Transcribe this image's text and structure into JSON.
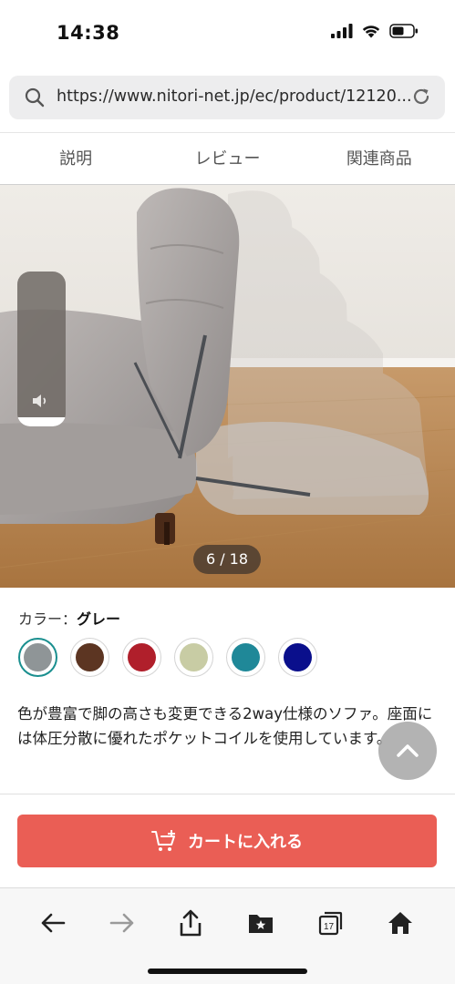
{
  "status_bar": {
    "time": "14:38"
  },
  "browser": {
    "url": "https://www.nitori-net.jp/ec/product/12120..."
  },
  "tabs": [
    {
      "label": "説明"
    },
    {
      "label": "レビュー"
    },
    {
      "label": "関連商品"
    }
  ],
  "gallery": {
    "counter": "6 / 18"
  },
  "color": {
    "label": "カラー：",
    "selected": "グレー",
    "swatches": [
      {
        "name": "gray",
        "hex": "#8f9597"
      },
      {
        "name": "brown",
        "hex": "#5c3522"
      },
      {
        "name": "red",
        "hex": "#b01f2b"
      },
      {
        "name": "sage",
        "hex": "#c8cca4"
      },
      {
        "name": "teal",
        "hex": "#1f8898"
      },
      {
        "name": "navy",
        "hex": "#0a0f8c"
      }
    ]
  },
  "description": "色が豊富で脚の高さも変更できる2way仕様のソファ。座面には体圧分散に優れたポケットコイルを使用しています。",
  "cart": {
    "label": "カートに入れる"
  },
  "toolbar": {
    "tab_count": "17"
  },
  "colors": {
    "accent": "#ea5e55",
    "selected_ring": "#1a8f8f"
  },
  "volume": {
    "level": 0.06
  }
}
